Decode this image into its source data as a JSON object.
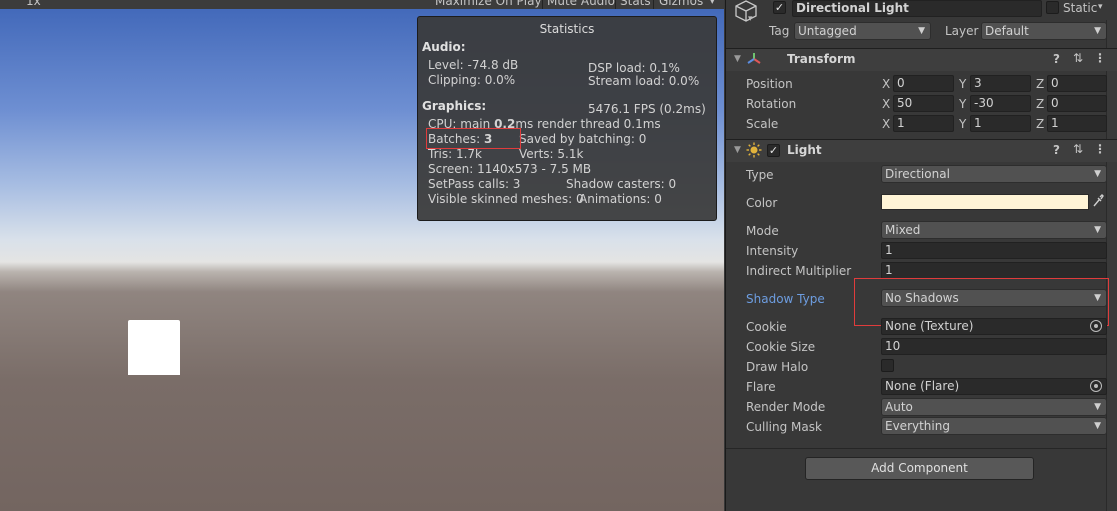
{
  "game_toolbar": {
    "scale_label": "1x",
    "maximize_label": "Maximize On Play",
    "mute_label": "Mute Audio",
    "stats_label": "Stats",
    "gizmos_label": "Gizmos"
  },
  "stats": {
    "title": "Statistics",
    "audio_header": "Audio:",
    "level": "Level: -74.8 dB",
    "clipping": "Clipping: 0.0%",
    "dsp_load": "DSP load: 0.1%",
    "stream_load": "Stream load: 0.0%",
    "graphics_header": "Graphics:",
    "fps": "5476.1 FPS (0.2ms)",
    "cpu_prefix": "CPU: main ",
    "cpu_main": "0.2",
    "cpu_suffix": "ms  render thread 0.1ms",
    "batches_prefix": "Batches: ",
    "batches_value": "3",
    "saved_by_batching": "Saved by batching: 0",
    "tris": "Tris: 1.7k",
    "verts": "Verts: 5.1k",
    "screen": "Screen: 1140x573 - 7.5 MB",
    "setpass": "SetPass calls: 3",
    "shadow_casters": "Shadow casters: 0",
    "skinned": "Visible skinned meshes: 0",
    "animations": "Animations: 0"
  },
  "inspector": {
    "object_name": "Directional Light",
    "static_label": "Static",
    "tag_label": "Tag",
    "tag_value": "Untagged",
    "layer_label": "Layer",
    "layer_value": "Default",
    "transform": {
      "title": "Transform",
      "position_label": "Position",
      "rotation_label": "Rotation",
      "scale_label": "Scale",
      "axis_x": "X",
      "axis_y": "Y",
      "axis_z": "Z",
      "position": [
        "0",
        "3",
        "0"
      ],
      "rotation": [
        "50",
        "-30",
        "0"
      ],
      "scale": [
        "1",
        "1",
        "1"
      ]
    },
    "light": {
      "title": "Light",
      "type_label": "Type",
      "type_value": "Directional",
      "color_label": "Color",
      "color_value": "#fff4d6",
      "mode_label": "Mode",
      "mode_value": "Mixed",
      "intensity_label": "Intensity",
      "intensity_value": "1",
      "indirect_label": "Indirect Multiplier",
      "indirect_value": "1",
      "shadow_type_label": "Shadow Type",
      "shadow_type_value": "No Shadows",
      "cookie_label": "Cookie",
      "cookie_value": "None (Texture)",
      "cookie_size_label": "Cookie Size",
      "cookie_size_value": "10",
      "draw_halo_label": "Draw Halo",
      "flare_label": "Flare",
      "flare_value": "None (Flare)",
      "render_mode_label": "Render Mode",
      "render_mode_value": "Auto",
      "culling_mask_label": "Culling Mask",
      "culling_mask_value": "Everything"
    },
    "add_component_label": "Add Component"
  },
  "colors": {
    "highlight_label": "#6d9de0",
    "annotation_red": "#e03c3c",
    "light_color_swatch": "#fff4d6"
  }
}
